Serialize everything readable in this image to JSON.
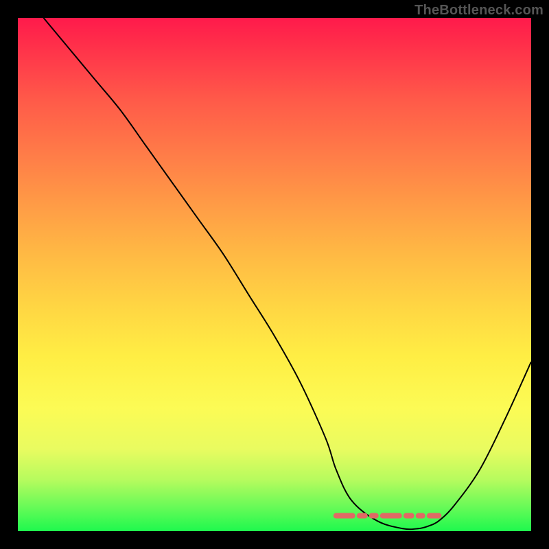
{
  "watermark": "TheBottleneck.com",
  "chart_data": {
    "type": "line",
    "title": "",
    "xlabel": "",
    "ylabel": "",
    "xlim": [
      0,
      100
    ],
    "ylim": [
      0,
      100
    ],
    "grid": false,
    "legend": false,
    "series": [
      {
        "name": "bottleneck-curve",
        "x": [
          5,
          10,
          15,
          20,
          25,
          30,
          35,
          40,
          45,
          50,
          55,
          60,
          62,
          65,
          70,
          75,
          78,
          80,
          82,
          85,
          90,
          95,
          100
        ],
        "y": [
          100,
          94,
          88,
          82,
          75,
          68,
          61,
          54,
          46,
          38,
          29,
          18,
          12,
          6,
          2,
          0.5,
          0.5,
          1,
          2,
          5,
          12,
          22,
          33
        ],
        "color": "#000000"
      }
    ],
    "annotations": [
      {
        "name": "optimal-range-marker",
        "type": "band",
        "x_range": [
          62,
          82
        ],
        "y": 3,
        "color": "#e06a64"
      }
    ],
    "background_gradient": {
      "direction": "vertical",
      "stops": [
        {
          "pos": 0.0,
          "color": "#ff1a4b"
        },
        {
          "pos": 0.36,
          "color": "#ff9a46"
        },
        {
          "pos": 0.66,
          "color": "#ffee44"
        },
        {
          "pos": 0.9,
          "color": "#b6fb5e"
        },
        {
          "pos": 1.0,
          "color": "#1ef94e"
        }
      ]
    }
  }
}
